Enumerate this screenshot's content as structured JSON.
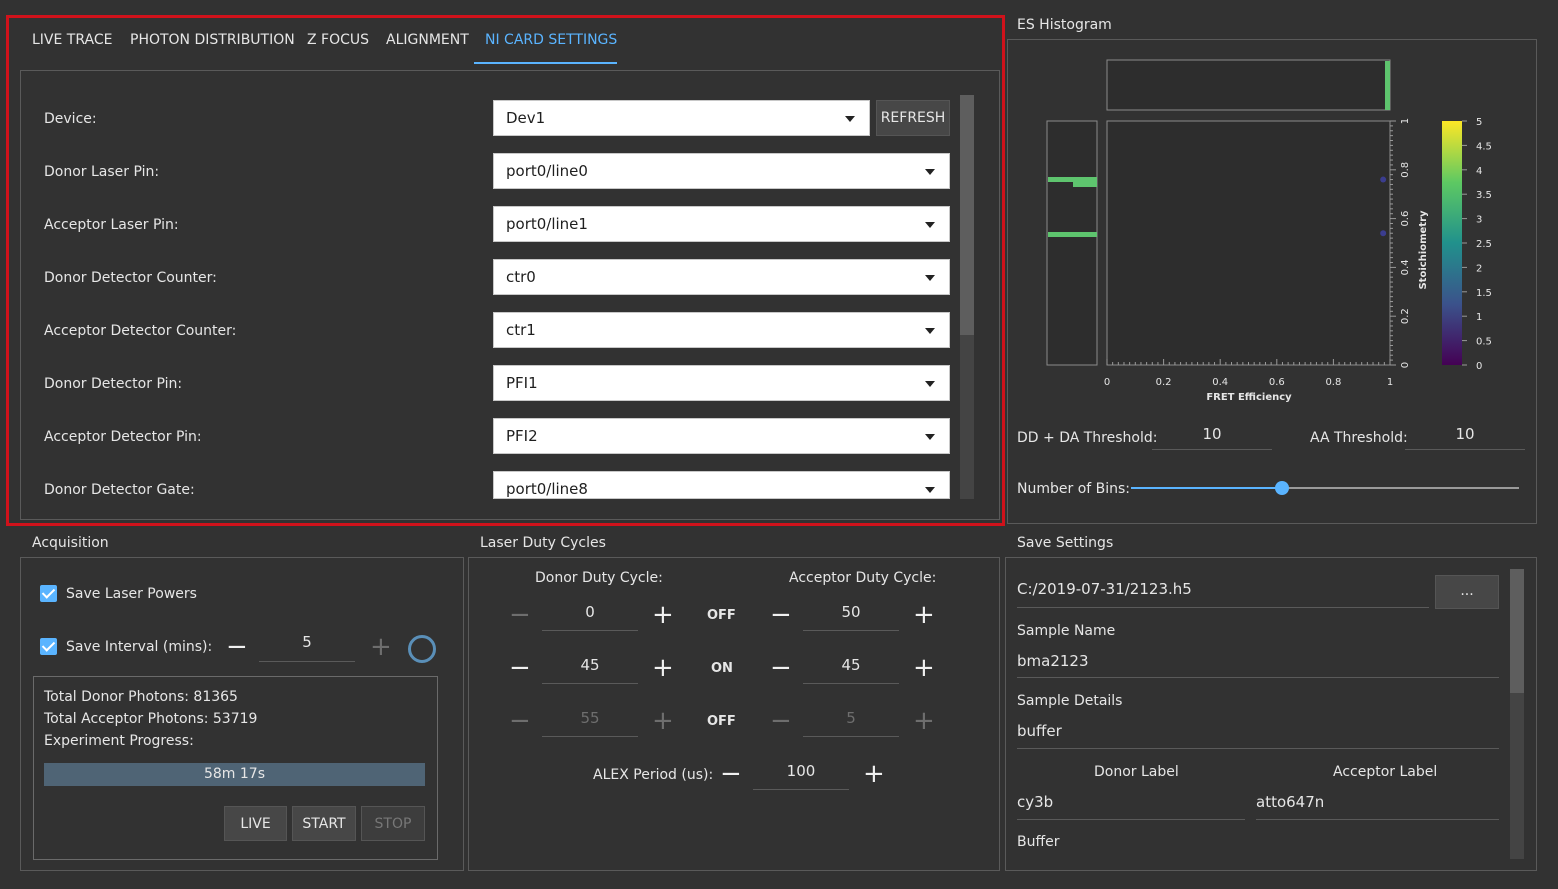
{
  "tabs": [
    {
      "label": "LIVE TRACE"
    },
    {
      "label": "PHOTON DISTRIBUTION"
    },
    {
      "label": "Z FOCUS"
    },
    {
      "label": "ALIGNMENT"
    },
    {
      "label": "NI CARD SETTINGS",
      "active": true
    }
  ],
  "ni_card": {
    "refresh_label": "REFRESH",
    "fields": [
      {
        "label": "Device:",
        "value": "Dev1"
      },
      {
        "label": "Donor Laser Pin:",
        "value": "port0/line0"
      },
      {
        "label": "Acceptor Laser Pin:",
        "value": "port0/line1"
      },
      {
        "label": "Donor Detector Counter:",
        "value": "ctr0"
      },
      {
        "label": "Acceptor Detector Counter:",
        "value": "ctr1"
      },
      {
        "label": "Donor Detector Pin:",
        "value": "PFI1"
      },
      {
        "label": "Acceptor Detector Pin:",
        "value": "PFI2"
      },
      {
        "label": "Donor Detector Gate:",
        "value": "port0/line8"
      }
    ]
  },
  "es_histogram": {
    "title": "ES Histogram",
    "dd_da_threshold_label": "DD + DA Threshold:",
    "dd_da_threshold": "10",
    "aa_threshold_label": "AA Threshold:",
    "aa_threshold": "10",
    "bins_label": "Number of Bins:",
    "bins_slider_fraction": 0.39
  },
  "chart_data": {
    "type": "scatter",
    "xlabel": "FRET Efficiency",
    "ylabel": "Stoichiometry",
    "xlim": [
      0,
      1
    ],
    "ylim": [
      0,
      1
    ],
    "x_ticks": [
      "0",
      "0.2",
      "0.4",
      "0.6",
      "0.8",
      "1"
    ],
    "y_ticks": [
      "0",
      "0.2",
      "0.4",
      "0.6",
      "0.8",
      "1"
    ],
    "points": [
      {
        "x": 0.99,
        "y": 0.76
      },
      {
        "x": 0.99,
        "y": 0.54
      }
    ],
    "colorbar_ticks": [
      "0",
      "0.5",
      "1",
      "1.5",
      "2",
      "2.5",
      "3",
      "3.5",
      "4",
      "4.5",
      "5"
    ],
    "colorbar_range": [
      0,
      5
    ]
  },
  "acquisition": {
    "title": "Acquisition",
    "save_laser_powers": "Save Laser Powers",
    "save_interval_label": "Save Interval (mins):",
    "save_interval": "5",
    "total_donor": "Total    Donor Photons: 81365",
    "total_acceptor": "Total Acceptor Photons: 53719",
    "progress_label": "Experiment Progress:",
    "progress_text": "58m 17s",
    "live": "LIVE",
    "start": "START",
    "stop": "STOP"
  },
  "laser": {
    "title": "Laser Duty Cycles",
    "donor_label": "Donor Duty Cycle:",
    "acceptor_label": "Acceptor Duty Cycle:",
    "rows": [
      {
        "donor": "0",
        "state": "OFF",
        "acceptor": "50"
      },
      {
        "donor": "45",
        "state": "ON",
        "acceptor": "45"
      },
      {
        "donor": "55",
        "state": "OFF",
        "acceptor": "5"
      }
    ],
    "alex_label": "ALEX Period (us):",
    "alex_value": "100"
  },
  "save": {
    "title": "Save Settings",
    "path": "C:/2019-07-31/2123.h5",
    "browse": "...",
    "sample_name_label": "Sample Name",
    "sample_name": "bma2123",
    "sample_details_label": "Sample Details",
    "sample_details": "buffer",
    "donor_label_label": "Donor Label",
    "donor_label": "cy3b",
    "acceptor_label_label": "Acceptor Label",
    "acceptor_label": "atto647n",
    "buffer_label": "Buffer"
  },
  "colors": {
    "accent": "#5ab4ff",
    "highlight": "#d0121b",
    "hist_bar": "#5ec46e"
  }
}
